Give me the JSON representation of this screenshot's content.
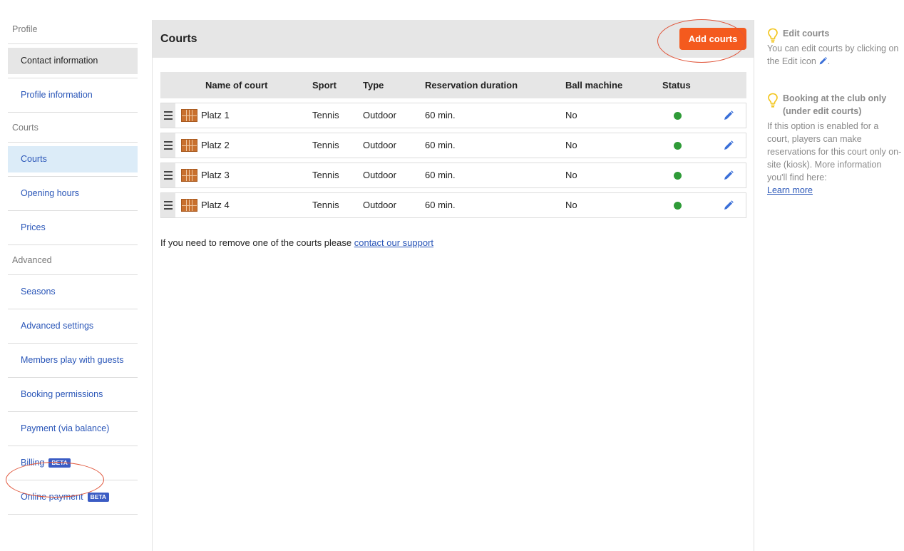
{
  "sidebar": {
    "sections": [
      {
        "title": "Profile",
        "items": [
          {
            "label": "Contact information",
            "state": "active-grey"
          },
          {
            "label": "Profile information",
            "state": ""
          }
        ]
      },
      {
        "title": "Courts",
        "items": [
          {
            "label": "Courts",
            "state": "active-blue"
          },
          {
            "label": "Opening hours",
            "state": ""
          },
          {
            "label": "Prices",
            "state": ""
          }
        ]
      },
      {
        "title": "Advanced",
        "items": [
          {
            "label": "Seasons",
            "state": ""
          },
          {
            "label": "Advanced settings",
            "state": ""
          },
          {
            "label": "Members play with guests",
            "state": ""
          },
          {
            "label": "Booking permissions",
            "state": ""
          },
          {
            "label": "Payment (via balance)",
            "state": ""
          },
          {
            "label": "Billing",
            "state": "",
            "badge": "BETA"
          },
          {
            "label": "Online payment",
            "state": "",
            "badge": "BETA"
          }
        ]
      }
    ]
  },
  "main": {
    "title": "Courts",
    "add_button": "Add courts",
    "columns": [
      "Name of court",
      "Sport",
      "Type",
      "Reservation duration",
      "Ball machine",
      "Status"
    ],
    "rows": [
      {
        "name": "Platz 1",
        "sport": "Tennis",
        "type": "Outdoor",
        "duration": "60 min.",
        "ball_machine": "No",
        "status": "active"
      },
      {
        "name": "Platz 2",
        "sport": "Tennis",
        "type": "Outdoor",
        "duration": "60 min.",
        "ball_machine": "No",
        "status": "active"
      },
      {
        "name": "Platz 3",
        "sport": "Tennis",
        "type": "Outdoor",
        "duration": "60 min.",
        "ball_machine": "No",
        "status": "active"
      },
      {
        "name": "Platz 4",
        "sport": "Tennis",
        "type": "Outdoor",
        "duration": "60 min.",
        "ball_machine": "No",
        "status": "active"
      }
    ],
    "note_text": "If you need to remove one of the courts please ",
    "note_link": "contact our support"
  },
  "tips": [
    {
      "title": "Edit courts",
      "body": "You can edit courts by clicking on the Edit icon",
      "body_suffix": ".",
      "link": ""
    },
    {
      "title": "Booking at the club only (under edit courts)",
      "body": "If this option is enabled for a court, players can make reservations for this court only on-site (kiosk). More information you'll find here:",
      "body_suffix": "",
      "link": "Learn more"
    }
  ],
  "colors": {
    "accent": "#f45a1e",
    "link": "#2a56b8",
    "status_active": "#2f9b38",
    "highlight_ellipse": "#e0553a",
    "bulb": "#f2c418"
  }
}
